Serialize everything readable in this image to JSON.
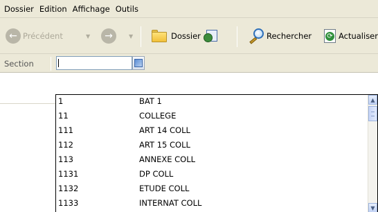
{
  "menu": [
    "Dossier",
    "Edition",
    "Affichage",
    "Outils"
  ],
  "toolbar": {
    "back_label": "Précédent",
    "folders_label": "Dossier",
    "search_label": "Rechercher",
    "refresh_label": "Actualiser",
    "icons": {
      "back": "back-arrow-icon",
      "forward": "forward-arrow-icon",
      "folders": "folder-icon",
      "history": "history-icon",
      "search": "search-icon",
      "refresh": "refresh-icon"
    }
  },
  "section": {
    "label": "Section",
    "value": ""
  },
  "list": [
    {
      "code": "1",
      "label": "BAT 1"
    },
    {
      "code": "11",
      "label": "COLLEGE"
    },
    {
      "code": "111",
      "label": "ART 14 COLL"
    },
    {
      "code": "112",
      "label": "ART 15 COLL"
    },
    {
      "code": "113",
      "label": "ANNEXE COLL"
    },
    {
      "code": "1131",
      "label": "DP COLL"
    },
    {
      "code": "1132",
      "label": "ETUDE COLL"
    },
    {
      "code": "1133",
      "label": "INTERNAT COLL"
    }
  ],
  "colors": {
    "chrome": "#ece9d8",
    "scrollbar": "#c3d3f5"
  }
}
